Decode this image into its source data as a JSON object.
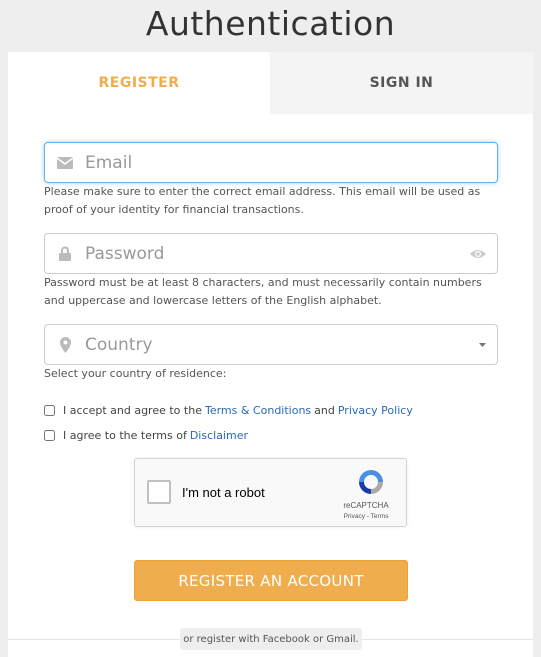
{
  "page": {
    "title": "Authentication"
  },
  "tabs": [
    {
      "label": "REGISTER",
      "active": true
    },
    {
      "label": "SIGN IN",
      "active": false
    }
  ],
  "form": {
    "email": {
      "value": "",
      "placeholder": "Email",
      "icon": "envelope-icon",
      "help": "Please make sure to enter the correct email address. This email will be used as proof of your identity for financial transactions."
    },
    "password": {
      "value": "",
      "placeholder": "Password",
      "icon": "lock-icon",
      "toggle_icon": "eye-icon",
      "help": "Password must be at least 8 characters, and must necessarily contain numbers and uppercase and lowercase letters of the English alphabet."
    },
    "country": {
      "selected": "Country",
      "icon": "map-marker-icon",
      "help": "Select your country of residence:"
    },
    "terms": {
      "prefix": "I accept and agree to the",
      "link1": "Terms & Conditions",
      "middle": "and",
      "link2": "Privacy Policy",
      "checked": false
    },
    "disclaimer": {
      "prefix": "I agree to the terms of",
      "link": "Disclaimer",
      "checked": false
    },
    "recaptcha": {
      "label": "I'm not a robot",
      "brand": "reCAPTCHA",
      "terms": "Privacy - Terms"
    },
    "submit_label": "REGISTER AN ACCOUNT",
    "social_divider": "or register with Facebook or Gmail."
  },
  "colors": {
    "accent": "#f0ad4e",
    "link": "#2a6ab8",
    "focus": "#66afe9"
  }
}
